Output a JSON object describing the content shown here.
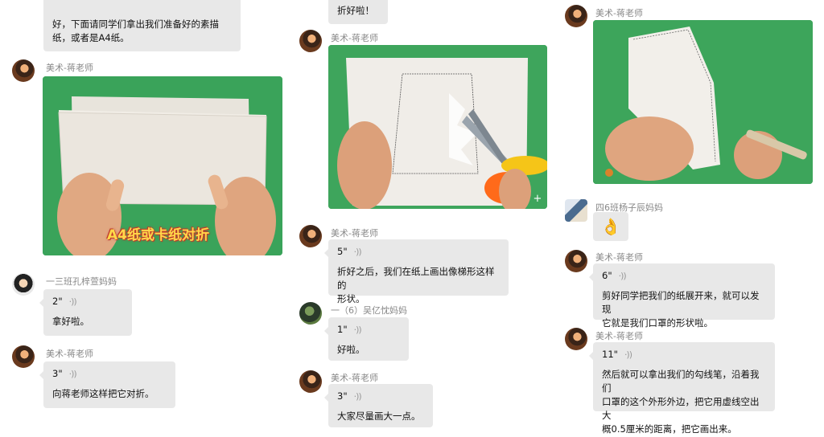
{
  "column1": {
    "top_bubble": "好，下面请同学们拿出我们准备好的素描\n纸，或者是A4纸。",
    "teacher_name_1": "美术-蒋老师",
    "photo_caption": "A4纸或卡纸对折",
    "student1_name": "一三班孔梓萱妈妈",
    "student1_duration": "2\"",
    "student1_text": "拿好啦。",
    "teacher_name_2": "美术-蒋老师",
    "teacher2_duration": "3\"",
    "teacher2_text": "向蒋老师这样把它对折。"
  },
  "column2": {
    "top_bubble": "折好啦！",
    "teacher_name_1": "美术-蒋老师",
    "teacher_name_2": "美术-蒋老师",
    "teacher2_duration": "5\"",
    "teacher2_text": "折好之后，我们在纸上画出像梯形这样的\n形状。",
    "student_name": "一（6）吴亿忱妈妈",
    "student_duration": "1\"",
    "student_text": "好啦。",
    "teacher_name_3": "美术-蒋老师",
    "teacher3_duration": "3\"",
    "teacher3_text": "大家尽量画大一点。"
  },
  "column3": {
    "teacher_name_1": "美术-蒋老师",
    "student_name": "四6班杨子辰妈妈",
    "student_emoji": "👌",
    "teacher_name_2": "美术-蒋老师",
    "teacher2_duration": "6\"",
    "teacher2_text": "剪好同学把我们的纸展开来，就可以发现\n它就是我们口罩的形状啦。",
    "teacher_name_3": "美术-蒋老师",
    "teacher3_duration": "11\"",
    "teacher3_text": "然后就可以拿出我们的勾线笔，沿着我们\n口罩的这个外形外边，把它用虚线空出大\n概0.5厘米的距离，把它画出来。"
  },
  "icons": {
    "voice": "voice-wave-icon",
    "plus": "plus-icon",
    "ok_hand": "ok-hand-emoji"
  },
  "colors": {
    "bubble": "#e8e8e8",
    "photo_bg": "#3aa35a",
    "name": "#888888"
  }
}
